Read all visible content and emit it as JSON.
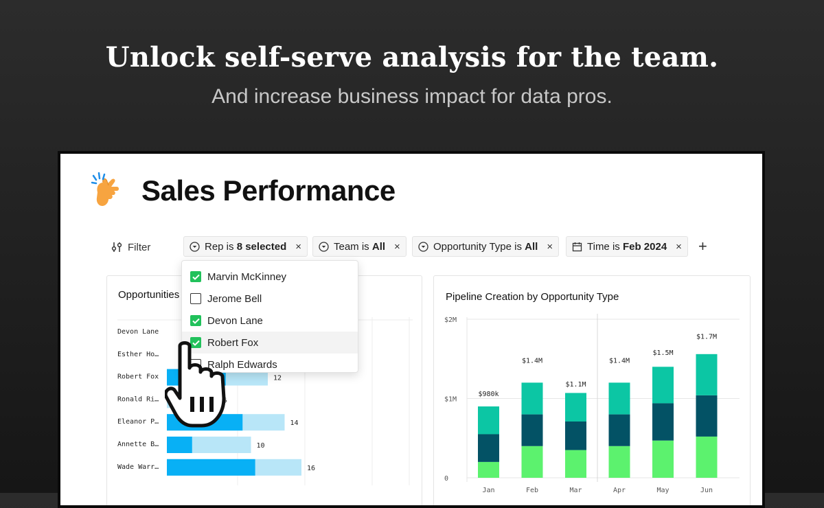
{
  "hero": {
    "title": "Unlock self-serve analysis for the team.",
    "subtitle": "And increase business impact for data pros."
  },
  "dashboard": {
    "title": "Sales Performance",
    "emoji": "finger-snap-icon"
  },
  "filters": {
    "filter_label": "Filter",
    "chips": [
      {
        "field": "Rep is",
        "value": "8 selected",
        "icon": "chevron-circle-icon"
      },
      {
        "field": "Team is",
        "value": "All",
        "icon": "chevron-circle-icon"
      },
      {
        "field": "Opportunity Type is",
        "value": "All",
        "icon": "chevron-circle-icon"
      },
      {
        "field": "Time is",
        "value": "Feb 2024",
        "icon": "calendar-icon"
      }
    ],
    "close_glyph": "×",
    "add_glyph": "+"
  },
  "rep_dropdown": {
    "items": [
      {
        "label": "Marvin McKinney",
        "checked": true
      },
      {
        "label": "Jerome Bell",
        "checked": false
      },
      {
        "label": "Devon Lane",
        "checked": true
      },
      {
        "label": "Robert Fox",
        "checked": true
      },
      {
        "label": "Ralph Edwards",
        "checked": false
      }
    ]
  },
  "colors": {
    "accent_blue": "#08b0f5",
    "light_blue": "#b8e6f8",
    "teal": "#0cc6a4",
    "dark_teal": "#035265",
    "green": "#5cf26e",
    "check_green": "#21c15b"
  },
  "opportunities_chart": {
    "title": "Opportunities",
    "chart_data": {
      "type": "bar",
      "categories": [
        "Devon Lane",
        "Esther Ho…",
        "Robert Fox",
        "Ronald Ri…",
        "Eleanor P…",
        "Annette B…",
        "Wade Warr…"
      ],
      "series": [
        {
          "values": [
            null,
            null,
            7,
            null,
            9,
            3,
            10.5
          ]
        },
        {
          "values": [
            null,
            null,
            12,
            6,
            14,
            10,
            16
          ]
        }
      ],
      "data_labels": [
        "",
        "",
        "12",
        "6",
        "14",
        "10",
        "16"
      ]
    }
  },
  "pipeline_chart": {
    "title": "Pipeline Creation by Opportunity Type",
    "chart_data": {
      "type": "bar",
      "stacked": true,
      "categories": [
        "Jan",
        "Feb",
        "Mar",
        "Apr",
        "May",
        "Jun"
      ],
      "ylim": [
        0,
        2000000
      ],
      "y_ticks": [
        "0",
        "$1M",
        "$2M"
      ],
      "series": [
        {
          "values": [
            200000,
            400000,
            350000,
            400000,
            470000,
            520000
          ]
        },
        {
          "values": [
            350000,
            400000,
            360000,
            400000,
            470000,
            520000
          ]
        },
        {
          "values": [
            350000,
            400000,
            360000,
            400000,
            460000,
            520000
          ]
        }
      ],
      "totals": [
        980000,
        1400000,
        1100000,
        1400000,
        1500000,
        1700000
      ],
      "total_labels": [
        "$980k",
        "$1.4M",
        "$1.1M",
        "$1.4M",
        "$1.5M",
        "$1.7M"
      ]
    }
  }
}
